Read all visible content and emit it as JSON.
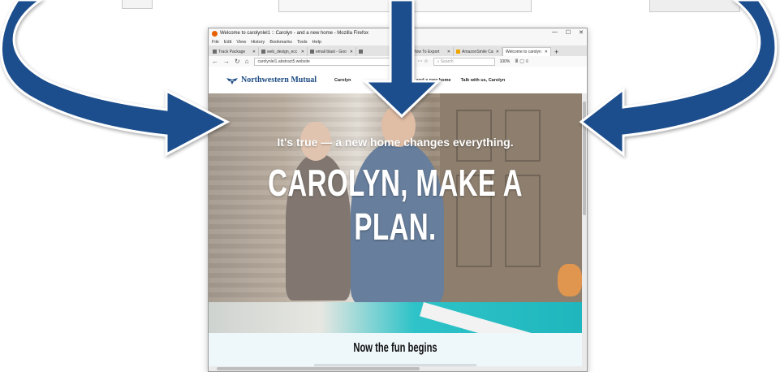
{
  "browser": {
    "window_title": "Welcome to carolynlel1 :: Carolyn - and a new home - Mozilla Firefox",
    "window_controls": [
      "—",
      "☐",
      "✕"
    ],
    "menu": [
      "File",
      "Edit",
      "View",
      "History",
      "Bookmarks",
      "Tools",
      "Help"
    ],
    "tabs": [
      {
        "label": "Track Package",
        "active": false
      },
      {
        "label": "web_design_ecc",
        "active": false
      },
      {
        "label": "email blast - Goo",
        "active": false
      },
      {
        "label": "",
        "active": false
      },
      {
        "label": "How To Export",
        "active": false
      },
      {
        "label": "AmazonSmile Ca",
        "active": false
      },
      {
        "label": "Welcome to carolyn",
        "active": true
      }
    ],
    "new_tab": "+",
    "url": "carolynlel1.abstract5.website",
    "search_placeholder": "Search",
    "zoom": "100%"
  },
  "site": {
    "logo": "Northwestern Mutual",
    "nav": [
      "Carolyn",
      "n - and a new home",
      "Talk with us, Carolyn"
    ],
    "hero_subtitle": "It's true — a new home changes everything.",
    "hero_title": "CAROLYN, MAKE A PLAN.",
    "section_title": "Now the fun begins"
  },
  "colors": {
    "arrow": "#1f4e8c",
    "brand": "#1b4a83"
  }
}
